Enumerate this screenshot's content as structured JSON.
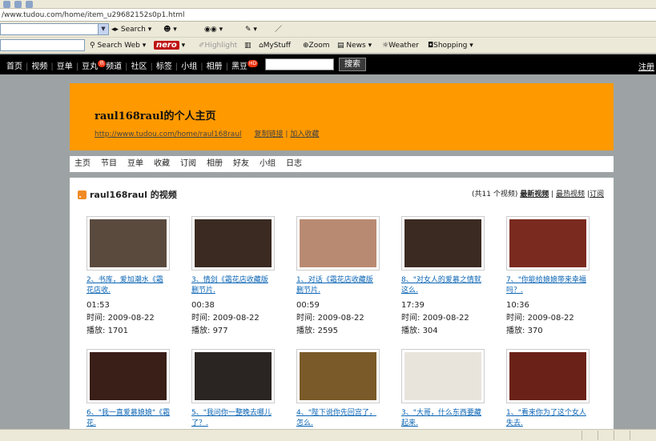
{
  "browser": {
    "address": "/www.tudou.com/home/item_u29682152s0p1.html",
    "toolbar1": {
      "search_label": "Search"
    },
    "toolbar2": {
      "search_web": "Search Web",
      "nero": "nero",
      "highlight": "Highlight",
      "mystuff": "MyStuff",
      "zoom": "Zoom",
      "news": "News",
      "weather": "Weather",
      "shopping": "Shopping"
    }
  },
  "nav": {
    "items": [
      "首页",
      "视频",
      "豆单",
      "豆丸",
      "频道",
      "社区",
      "标签",
      "小组",
      "相册",
      "黑豆"
    ],
    "hot_badge": "热",
    "hot_badge2": "HD",
    "search_button": "搜索",
    "register": "注册"
  },
  "profile": {
    "title": "raul168raul的个人主页",
    "url": "http://www.tudou.com/home/raul168raul",
    "copy_link": "复制链接",
    "divider": "|",
    "bookmark": "加入收藏"
  },
  "subnav": [
    "主页",
    "节目",
    "豆单",
    "收藏",
    "订阅",
    "相册",
    "好友",
    "小组",
    "日志"
  ],
  "videos_section": {
    "title": "raul168raul 的视频",
    "count_text": "(共11 个视频)",
    "sort_newest": "最新视频",
    "sort_hottest": "最热视频",
    "subscribe": "订阅",
    "sep": "|"
  },
  "labels": {
    "time": "时间: ",
    "plays": "播放: "
  },
  "videos_row1": [
    {
      "title": "2、书库，爱加潮水《霜花店收.",
      "duration": "01:53",
      "date": "2009-08-22",
      "plays": "1701",
      "color": "#5a4a3e"
    },
    {
      "title": "3、情剑《霜花店收藏版删节片.",
      "duration": "00:38",
      "date": "2009-08-22",
      "plays": "977",
      "color": "#3a2a22"
    },
    {
      "title": "1、对话《霜花店收藏版删节片.",
      "duration": "00:59",
      "date": "2009-08-22",
      "plays": "2595",
      "color": "#b98a72"
    },
    {
      "title": "8、\"对女人的爱慕之情就这么.",
      "duration": "17:39",
      "date": "2009-08-22",
      "plays": "304",
      "color": "#3b2a22"
    },
    {
      "title": "7、\"你能给娘娘带来幸福吗？.",
      "duration": "10:36",
      "date": "2009-08-22",
      "plays": "370",
      "color": "#7a2a1e"
    }
  ],
  "videos_row2": [
    {
      "title": "6、\"我一直爱慕娘娘\"《霜花.",
      "color": "#3a1f18"
    },
    {
      "title": "5、\"我问你一整晚去哪儿了？.",
      "color": "#2a2422"
    },
    {
      "title": "4、\"陛下说你先回宫了，怎么.",
      "color": "#7a5a28"
    },
    {
      "title": "3、\"大哥，什么东西要藏起来.",
      "color": "#e8e4dc"
    },
    {
      "title": "1、\"看来你为了这个女人失去.",
      "color": "#6a2218"
    }
  ]
}
